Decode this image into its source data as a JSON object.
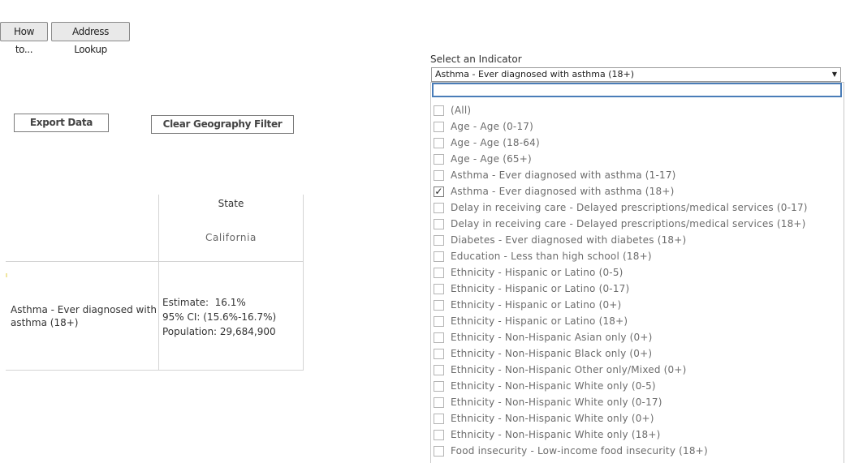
{
  "toolbar": {
    "howto_label": "How to...",
    "address_label": "Address Lookup"
  },
  "actions": {
    "export_label": "Export Data",
    "clear_label": "Clear Geography Filter"
  },
  "table": {
    "column_header": "State",
    "column_value": "California",
    "row_label": "Asthma - Ever diagnosed with asthma (18+)",
    "estimate": "Estimate:  16.1%",
    "ci": "95% CI: (15.6%-16.7%)",
    "population": "Population: 29,684,900"
  },
  "indicator": {
    "title": "Select an Indicator",
    "selected": "Asthma - Ever diagnosed with asthma (18+)",
    "search_placeholder": "",
    "options": [
      {
        "label": "(All)",
        "checked": false
      },
      {
        "label": "Age - Age (0-17)",
        "checked": false
      },
      {
        "label": "Age - Age (18-64)",
        "checked": false
      },
      {
        "label": "Age - Age (65+)",
        "checked": false
      },
      {
        "label": "Asthma - Ever diagnosed with asthma (1-17)",
        "checked": false
      },
      {
        "label": "Asthma - Ever diagnosed with asthma (18+)",
        "checked": true
      },
      {
        "label": "Delay in receiving care - Delayed prescriptions/medical services (0-17)",
        "checked": false
      },
      {
        "label": "Delay in receiving care - Delayed prescriptions/medical services (18+)",
        "checked": false
      },
      {
        "label": "Diabetes - Ever diagnosed with diabetes (18+)",
        "checked": false
      },
      {
        "label": "Education - Less than high school (18+)",
        "checked": false
      },
      {
        "label": "Ethnicity - Hispanic or Latino (0-5)",
        "checked": false
      },
      {
        "label": "Ethnicity - Hispanic or Latino (0-17)",
        "checked": false
      },
      {
        "label": "Ethnicity - Hispanic or Latino (0+)",
        "checked": false
      },
      {
        "label": "Ethnicity - Hispanic or Latino (18+)",
        "checked": false
      },
      {
        "label": "Ethnicity - Non-Hispanic Asian only (0+)",
        "checked": false
      },
      {
        "label": "Ethnicity - Non-Hispanic Black only (0+)",
        "checked": false
      },
      {
        "label": "Ethnicity - Non-Hispanic Other only/Mixed (0+)",
        "checked": false
      },
      {
        "label": "Ethnicity - Non-Hispanic White only (0-5)",
        "checked": false
      },
      {
        "label": "Ethnicity - Non-Hispanic White only (0-17)",
        "checked": false
      },
      {
        "label": "Ethnicity - Non-Hispanic White only (0+)",
        "checked": false
      },
      {
        "label": "Ethnicity - Non-Hispanic White only (18+)",
        "checked": false
      },
      {
        "label": "Food insecurity - Low-income food insecurity (18+)",
        "checked": false
      }
    ]
  }
}
